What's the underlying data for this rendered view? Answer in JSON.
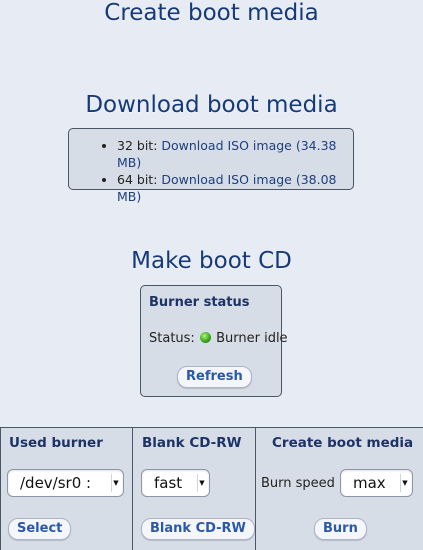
{
  "titles": {
    "main": "Create boot media",
    "download": "Download boot media",
    "make_cd": "Make boot CD"
  },
  "downloads": [
    {
      "prefix": "32 bit: ",
      "link": "Download ISO image (34.38 MB)"
    },
    {
      "prefix": "64 bit: ",
      "link": "Download ISO image (38.08 MB)"
    }
  ],
  "burner_status": {
    "header": "Burner status",
    "status_label": "Status:",
    "status_text": "Burner idle",
    "status_color": "#3aa81d",
    "refresh_label": "Refresh"
  },
  "panels": {
    "used_burner": {
      "title": "Used burner",
      "selected": "/dev/sr0 :",
      "button": "Select"
    },
    "blank_cdrw": {
      "title": "Blank CD-RW",
      "selected": "fast",
      "button": "Blank CD-RW"
    },
    "create_boot_media": {
      "title": "Create boot media",
      "speed_label": "Burn speed",
      "selected": "max",
      "button": "Burn"
    }
  },
  "colors": {
    "title": "#163a78",
    "background": "#e6ebf4",
    "box": "#d7dde6",
    "link": "#1d3f80",
    "button_text": "#2a5aa6"
  }
}
